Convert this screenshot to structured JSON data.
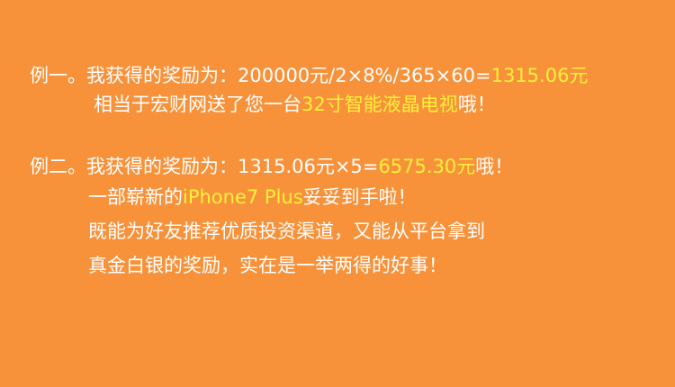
{
  "colors": {
    "background": "#f7923a",
    "text": "#ffffff",
    "highlight": "#fff13a"
  },
  "example1": {
    "line1_prefix": "例一。我获得的奖励为：200000元/2×8%/365×60=",
    "line1_highlight": "1315.06元",
    "line2_prefix": "相当于宏财网送了您一台",
    "line2_highlight": "32寸智能液晶电视",
    "line2_suffix": "哦！"
  },
  "example2": {
    "line1_prefix": "例二。我获得的奖励为：1315.06元×5=",
    "line1_highlight": "6575.30元",
    "line1_suffix": "哦！",
    "line2_prefix": "一部崭新的",
    "line2_highlight": "iPhone7 Plus",
    "line2_suffix": "妥妥到手啦！",
    "line3": "既能为好友推荐优质投资渠道，又能从平台拿到",
    "line4": "真金白银的奖励，实在是一举两得的好事！"
  }
}
